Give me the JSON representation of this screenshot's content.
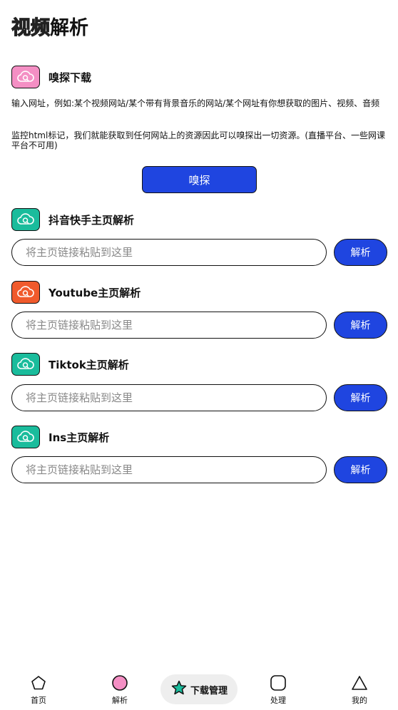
{
  "header": {
    "title_outline": "视频",
    "title_solid": "解析"
  },
  "sniff": {
    "title": "嗅探下载",
    "icon": "cloud-search-icon",
    "icon_color": "#f48fc4",
    "desc1": "输入网址，例如:某个视频网站/某个带有背景音乐的网站/某个网址有你想获取的图片、视频、音频",
    "desc2": "监控html标记，我们就能获取到任何网站上的资源因此可以嗅探出一切资源。(直播平台、一些网课平台不可用)",
    "button": "嗅探"
  },
  "sections": [
    {
      "title": "抖音快手主页解析",
      "icon_color": "#1abc9c",
      "placeholder": "将主页链接粘贴到这里",
      "button": "解析"
    },
    {
      "title": "Youtube主页解析",
      "icon_color": "#f05a2c",
      "placeholder": "将主页链接粘贴到这里",
      "button": "解析"
    },
    {
      "title": "Tiktok主页解析",
      "icon_color": "#1abc9c",
      "placeholder": "将主页链接粘贴到这里",
      "button": "解析"
    },
    {
      "title": "Ins主页解析",
      "icon_color": "#1abc9c",
      "placeholder": "将主页链接粘贴到这里",
      "button": "解析"
    }
  ],
  "nav": {
    "home": "首页",
    "parse": "解析",
    "download": "下载管理",
    "process": "处理",
    "mine": "我的"
  },
  "colors": {
    "accent": "#1f45e0",
    "pink": "#f48fc4",
    "teal": "#1abc9c",
    "orange": "#f05a2c"
  }
}
